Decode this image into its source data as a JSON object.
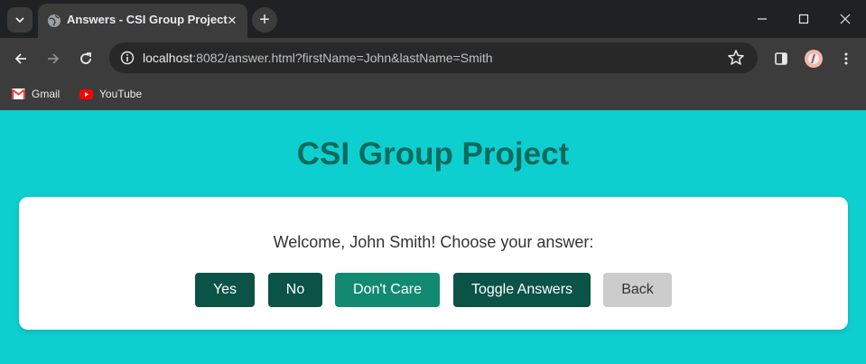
{
  "browser": {
    "tab": {
      "title": "Answers - CSI Group Project",
      "close": "✕"
    },
    "new_tab": "+",
    "address": {
      "host": "localhost",
      "path": ":8082/answer.html?firstName=John&lastName=Smith"
    },
    "bookmarks": [
      {
        "label": "Gmail"
      },
      {
        "label": "YouTube"
      }
    ]
  },
  "page": {
    "title": "CSI Group Project",
    "welcome": "Welcome, John Smith! Choose your answer:",
    "buttons": {
      "yes": "Yes",
      "no": "No",
      "dont_care": "Don't Care",
      "toggle": "Toggle Answers",
      "back": "Back"
    }
  },
  "colors": {
    "page_bg": "#0ecfcf",
    "title": "#0b6b5e",
    "dark_green": "#0b5346",
    "teal_button": "#128a72",
    "back_button": "#cccccc"
  }
}
